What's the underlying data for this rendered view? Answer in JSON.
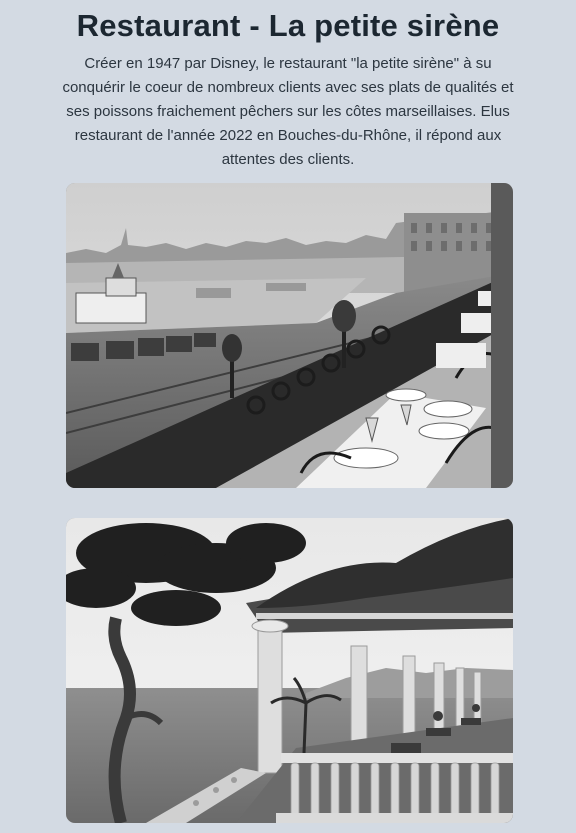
{
  "header": {
    "title": "Restaurant - La petite sirène"
  },
  "intro": {
    "text": "Créer en 1947 par Disney, le restaurant \"la petite sirène\" à su conquérir le coeur de nombreux clients avec ses plats de qualités et ses poissons fraichement pêchers sur les côtes marseillaises. Elus restaurant de l'année 2022 en Bouches-du-Rhône, il répond aux attentes des clients."
  },
  "gallery": {
    "photos": [
      {
        "subject": "historic-harbour-terrace-photo"
      },
      {
        "subject": "seaside-terrace-photo"
      }
    ]
  },
  "colors": {
    "background": "#d3dae3",
    "title": "#1c2731",
    "text": "#2c3640"
  }
}
